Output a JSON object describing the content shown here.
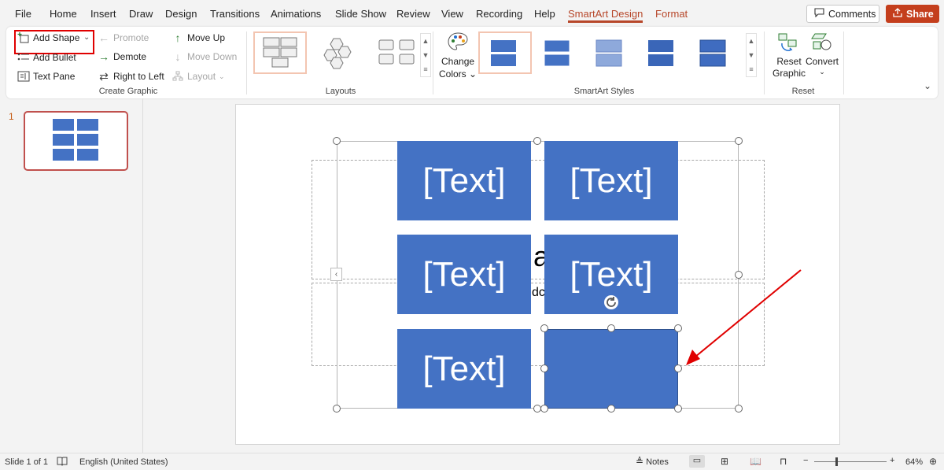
{
  "menu": {
    "items": [
      "File",
      "Home",
      "Insert",
      "Draw",
      "Design",
      "Transitions",
      "Animations",
      "Slide Show",
      "Review",
      "View",
      "Recording",
      "Help"
    ],
    "active_tab": "SmartArt Design",
    "format_tab": "Format",
    "comments_label": "Comments",
    "share_label": "Share"
  },
  "ribbon": {
    "create_graphic": {
      "add_shape": "Add Shape",
      "add_bullet": "Add Bullet",
      "text_pane": "Text Pane",
      "promote": "Promote",
      "demote": "Demote",
      "right_to_left": "Right to Left",
      "move_up": "Move Up",
      "move_down": "Move Down",
      "layout": "Layout",
      "label": "Create Graphic"
    },
    "layouts": {
      "label": "Layouts"
    },
    "smartart_styles": {
      "change_colors_line1": "Change",
      "change_colors_line2": "Colors",
      "label": "SmartArt Styles"
    },
    "reset": {
      "reset_graphic_line1": "Reset",
      "reset_graphic_line2": "Graphic",
      "convert": "Convert",
      "label": "Reset"
    }
  },
  "slides_panel": {
    "slide_number": "1"
  },
  "slide": {
    "title_fragment": "a",
    "subtitle_fragment": "dc",
    "boxes": [
      "[Text]",
      "[Text]",
      "[Text]",
      "[Text]",
      "[Text]",
      ""
    ]
  },
  "status": {
    "slide_info": "Slide 1 of 1",
    "language": "English (United States)",
    "notes": "Notes",
    "zoom": "64%"
  },
  "colors": {
    "accent": "#b7472a",
    "share": "#c43e1c",
    "smartart_fill": "#4472c4",
    "highlight": "#e00000"
  }
}
